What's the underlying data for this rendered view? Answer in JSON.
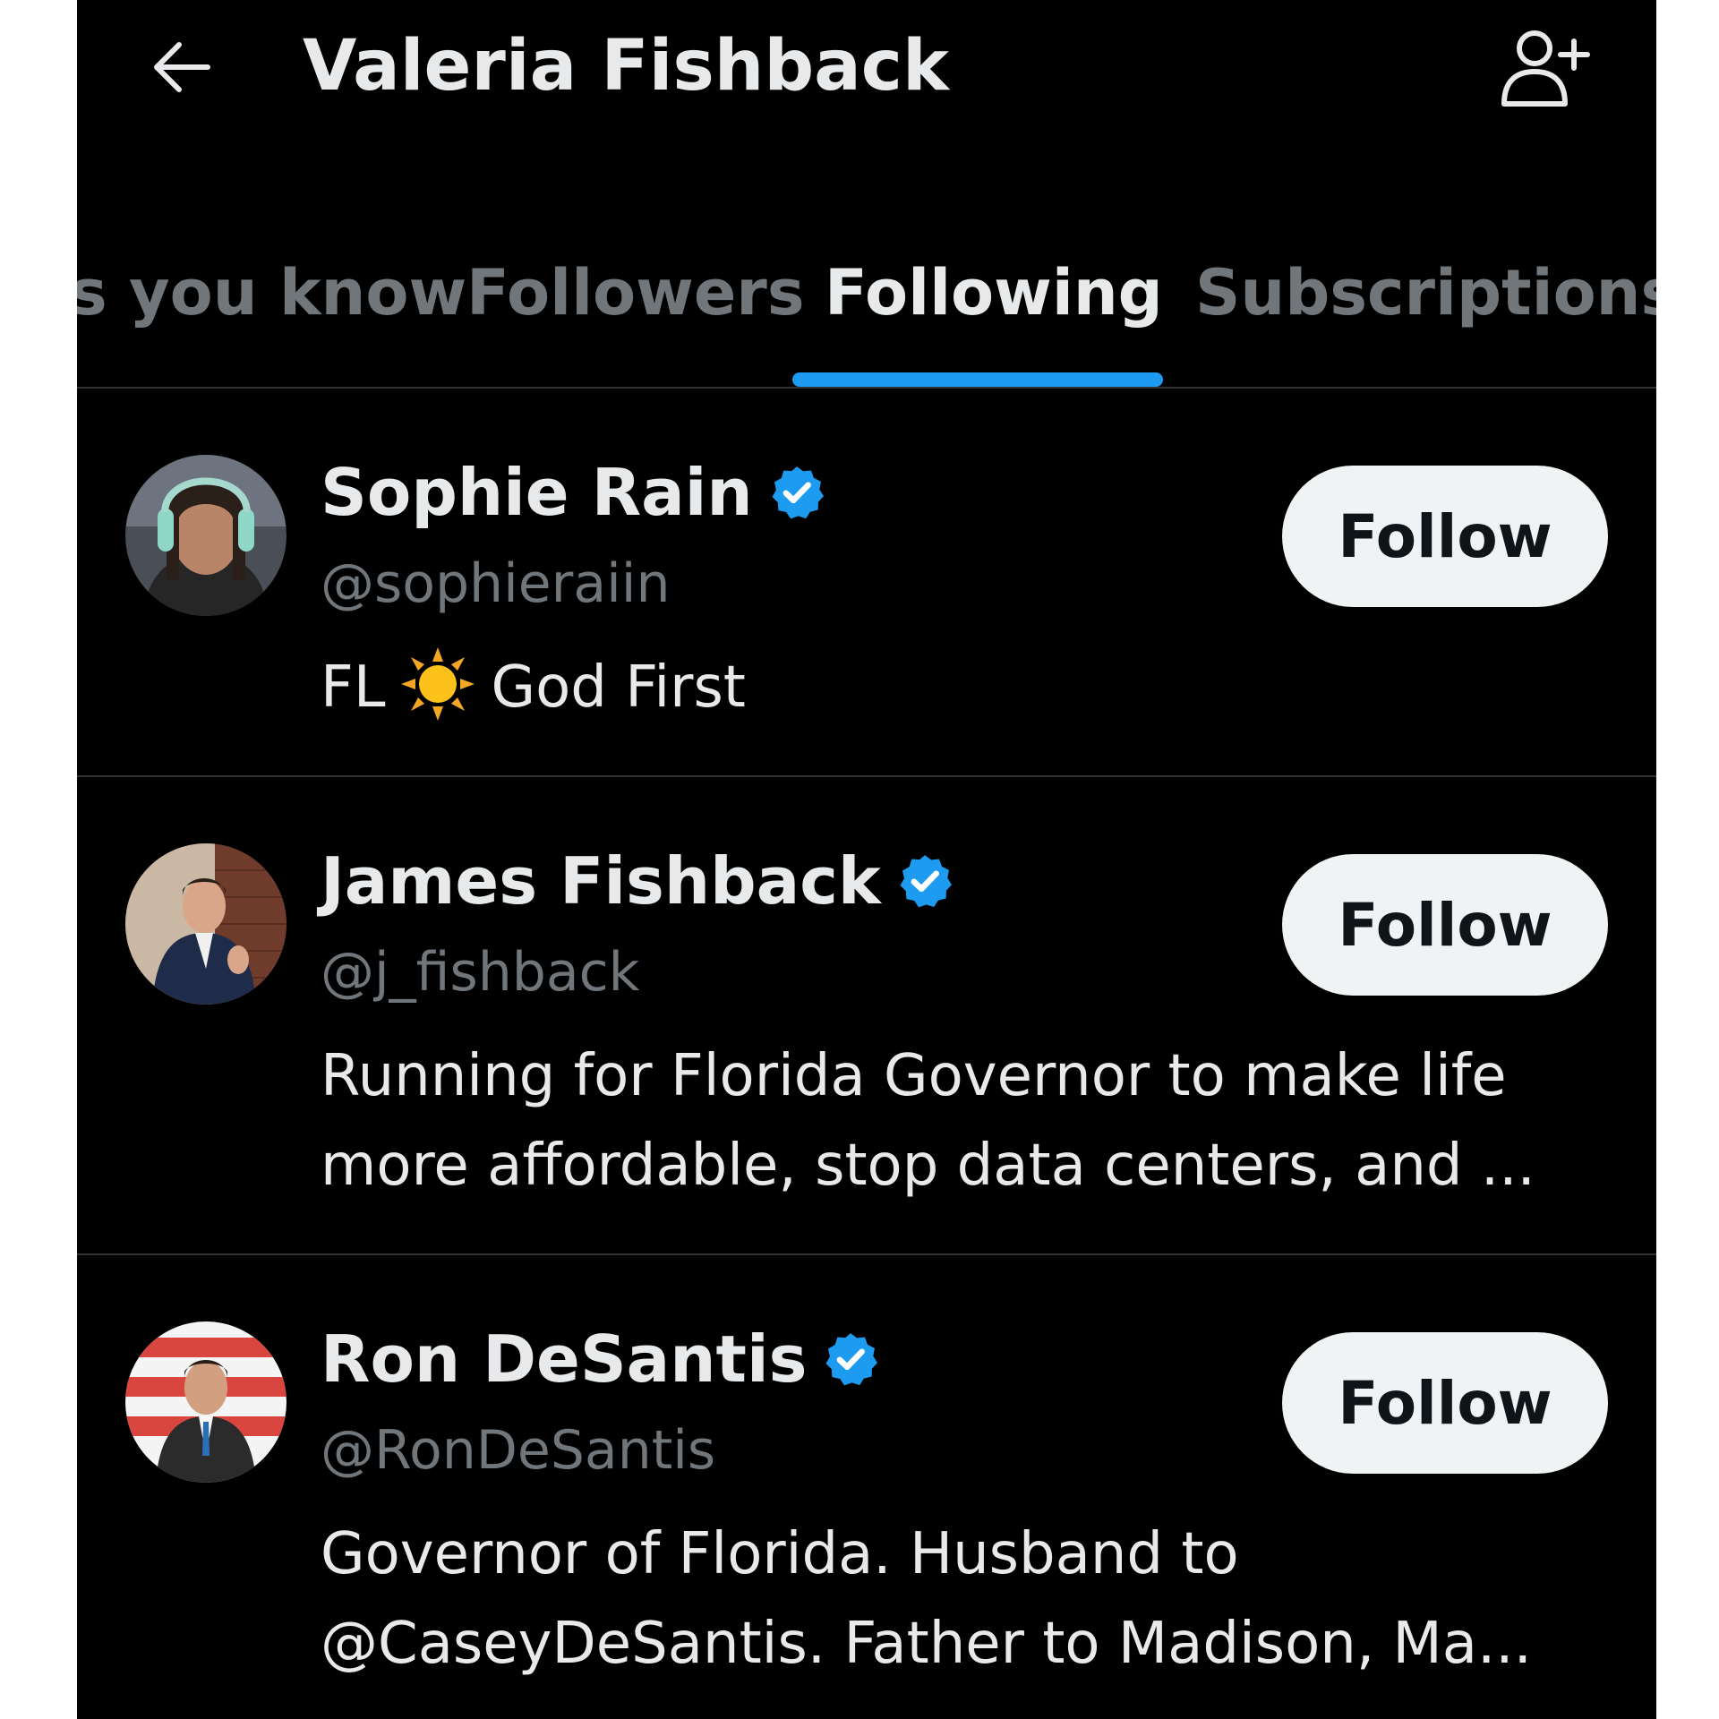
{
  "header": {
    "title": "Valeria Fishback",
    "back_icon": "arrow-left-icon",
    "add_user_icon": "person-plus-icon"
  },
  "tabs": [
    {
      "label": "s you know",
      "active": false
    },
    {
      "label": "Followers",
      "active": false
    },
    {
      "label": "Following",
      "active": true
    },
    {
      "label": "Subscriptions",
      "active": false
    }
  ],
  "users": [
    {
      "name": "Sophie Rain",
      "verified": true,
      "handle": "@sophieraiin",
      "bio_prefix": "FL",
      "bio_emoji": "sun-icon",
      "bio_suffix": "God First",
      "follow_label": "Follow"
    },
    {
      "name": "James Fishback",
      "verified": true,
      "handle": "@j_fishback",
      "bio_lines": [
        "Running for Florida Governor to make life",
        "more affordable, stop data centers, and ..."
      ],
      "follow_label": "Follow"
    },
    {
      "name": "Ron DeSantis",
      "verified": true,
      "handle": "@RonDeSantis",
      "bio_lines": [
        "Governor of Florida. Husband to",
        "@CaseyDeSantis. Father to Madison, Ma..."
      ],
      "follow_label": "Follow"
    }
  ],
  "colors": {
    "background": "#000000",
    "accent": "#1d9bf0",
    "text_primary": "#e7e9ea",
    "text_secondary": "#71767b",
    "button_bg": "#eff3f4"
  }
}
